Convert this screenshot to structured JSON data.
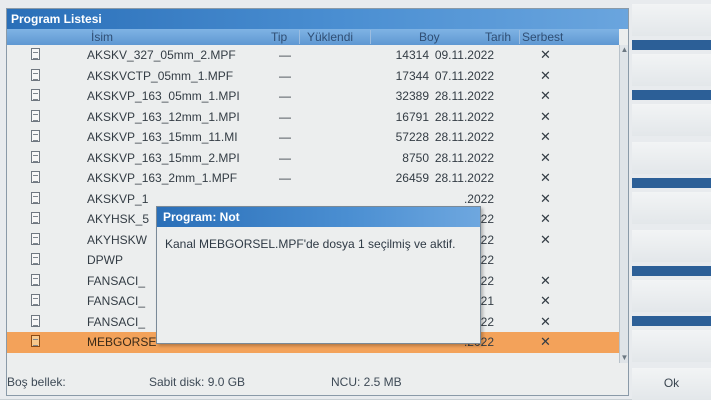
{
  "window": {
    "title": "Program Listesi"
  },
  "columns": {
    "name": "İsim",
    "tip": "Tip",
    "yuklendi": "Yüklendi",
    "boy": "Boy",
    "tarih": "Tarih",
    "serbest": "Serbest"
  },
  "rows": [
    {
      "name": "AKSKV_327_05mm_2.MPF",
      "tip": "—",
      "boy": "14314",
      "tarih": "09.11.2022",
      "serbest": "✕"
    },
    {
      "name": "AKSKVCTP_05mm_1.MPF",
      "tip": "—",
      "boy": "17344",
      "tarih": "07.11.2022",
      "serbest": "✕"
    },
    {
      "name": "AKSKVP_163_05mm_1.MPI",
      "tip": "—",
      "boy": "32389",
      "tarih": "28.11.2022",
      "serbest": "✕"
    },
    {
      "name": "AKSKVP_163_12mm_1.MPI",
      "tip": "—",
      "boy": "16791",
      "tarih": "28.11.2022",
      "serbest": "✕"
    },
    {
      "name": "AKSKVP_163_15mm_11.MI",
      "tip": "—",
      "boy": "57228",
      "tarih": "28.11.2022",
      "serbest": "✕"
    },
    {
      "name": "AKSKVP_163_15mm_2.MPI",
      "tip": "—",
      "boy": "8750",
      "tarih": "28.11.2022",
      "serbest": "✕"
    },
    {
      "name": "AKSKVP_163_2mm_1.MPF",
      "tip": "—",
      "boy": "26459",
      "tarih": "28.11.2022",
      "serbest": "✕"
    },
    {
      "name": "AKSKVP_1",
      "tip": "",
      "boy": "",
      "tarih": ".2022",
      "serbest": "✕"
    },
    {
      "name": "AKYHSK_5",
      "tip": "",
      "boy": "",
      "tarih": ".2022",
      "serbest": "✕"
    },
    {
      "name": "AKYHSKW",
      "tip": "",
      "boy": "",
      "tarih": ".2022",
      "serbest": "✕"
    },
    {
      "name": "DPWP",
      "tip": "",
      "boy": "",
      "tarih": ".2022",
      "serbest": ""
    },
    {
      "name": "FANSACI_",
      "tip": "",
      "boy": "",
      "tarih": ".2022",
      "serbest": "✕"
    },
    {
      "name": "FANSACI_",
      "tip": "",
      "boy": "",
      "tarih": ".2021",
      "serbest": "✕"
    },
    {
      "name": "FANSACI_",
      "tip": "",
      "boy": "",
      "tarih": ".2022",
      "serbest": "✕"
    },
    {
      "name": "MEBGORSE",
      "tip": "",
      "boy": "",
      "tarih": ".2022",
      "serbest": "✕"
    }
  ],
  "selected_row": 14,
  "status": {
    "bos_bellek": "Boş bellek:",
    "sabit_disk": "Sabit disk: 9.0 GB",
    "ncu": "NCU: 2.5 MB"
  },
  "dialog": {
    "title": "Program: Not",
    "message": "Kanal MEBGORSEL.MPF'de dosya 1 seçilmiş ve aktif."
  },
  "softkeys": {
    "ok": "Ok"
  },
  "colors": {
    "title_blue": "#2a6fb8",
    "selection_orange": "#f3a25a",
    "divider_blue": "#2c5f97"
  }
}
